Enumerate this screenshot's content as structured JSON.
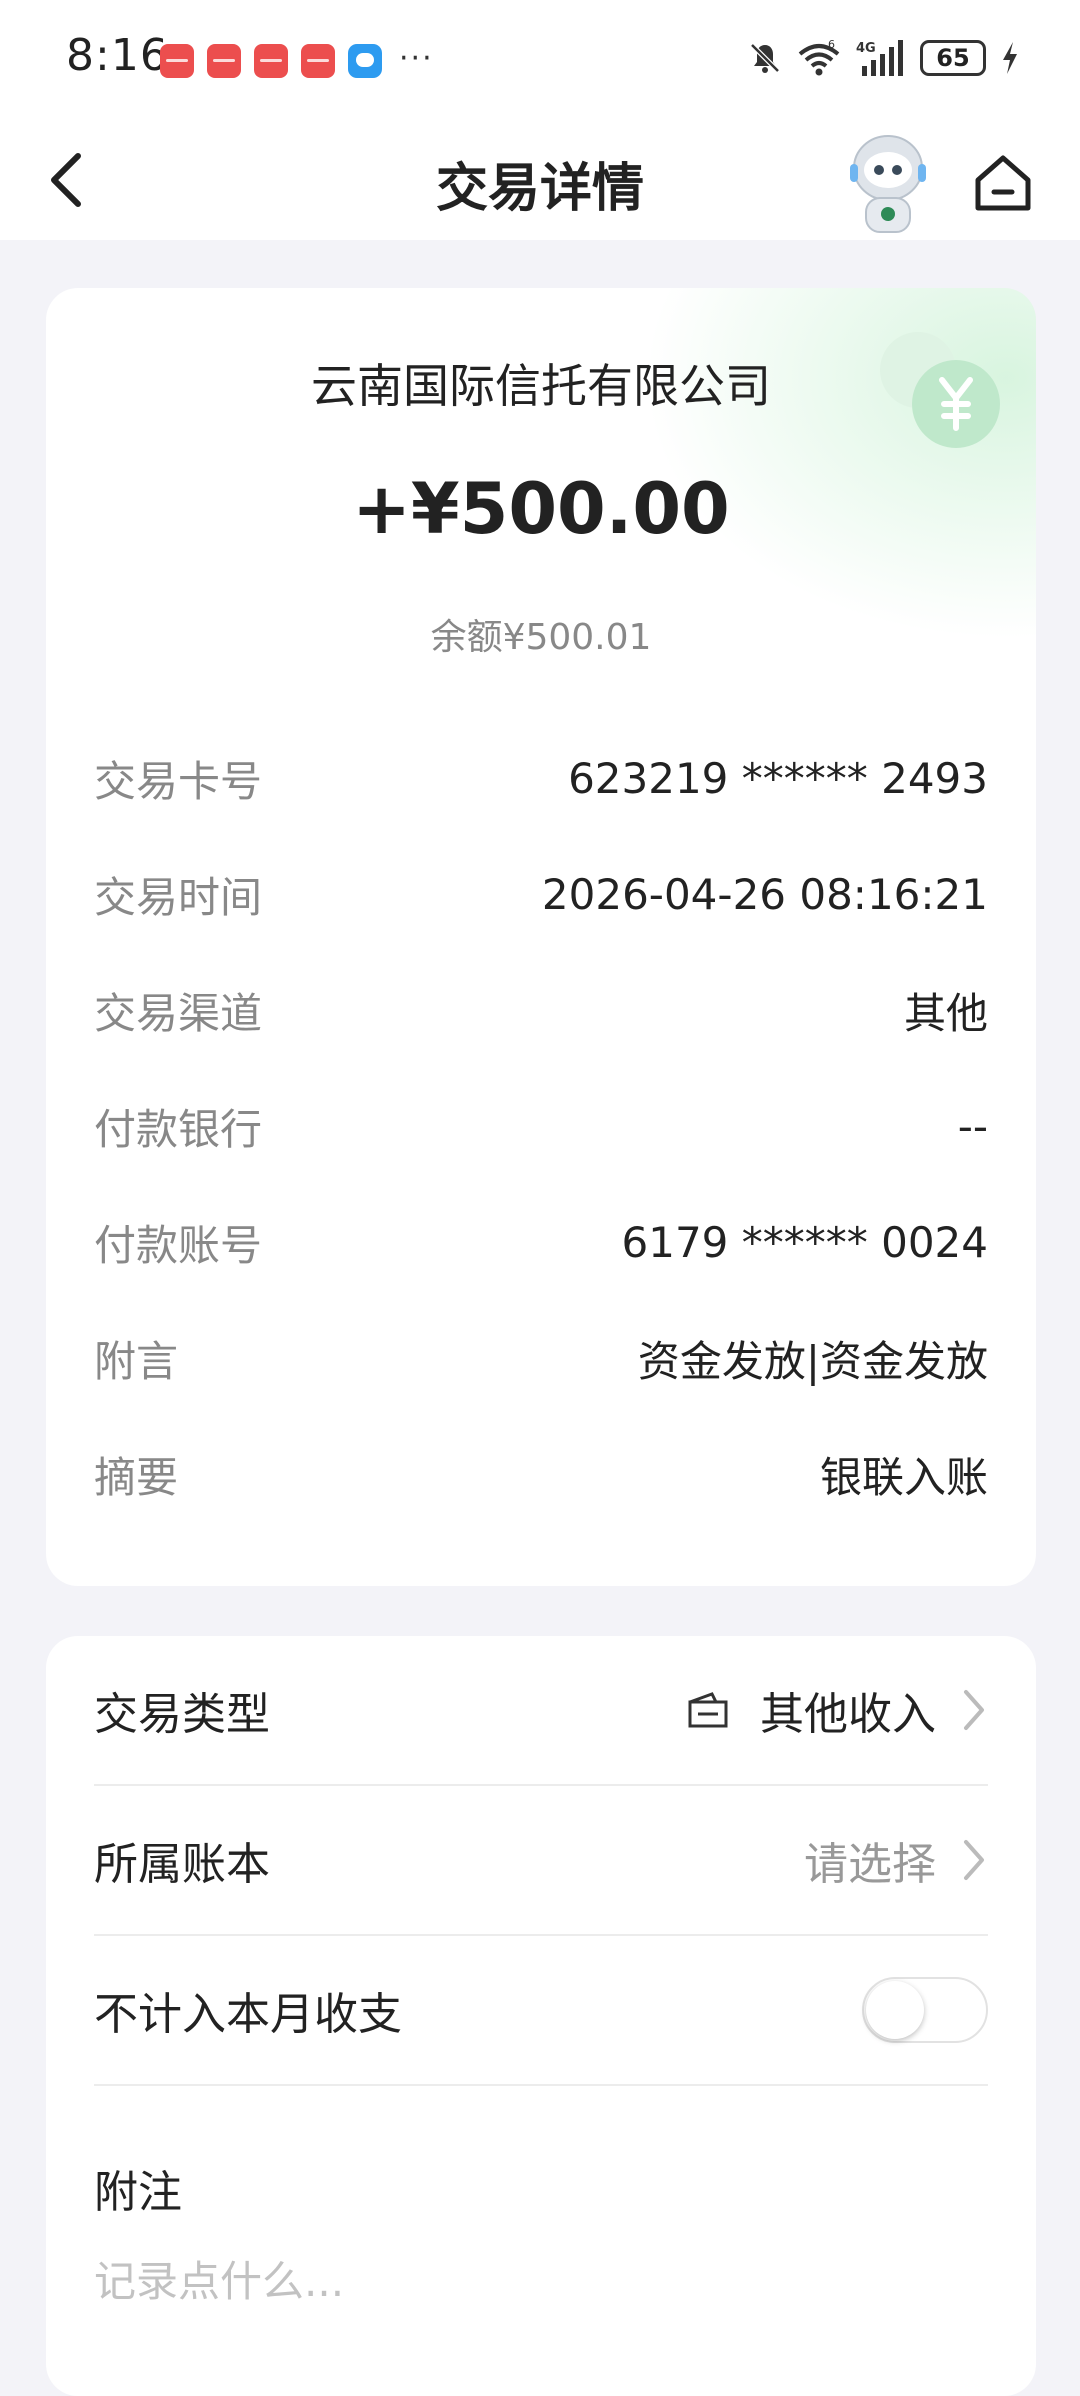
{
  "status_bar": {
    "time": "8:16",
    "notification_icons": [
      "huawei-store-icon",
      "huawei-store-icon",
      "huawei-store-icon",
      "huawei-store-icon",
      "message-icon"
    ],
    "more": "···",
    "battery": "65"
  },
  "nav": {
    "title": "交易详情"
  },
  "transaction": {
    "merchant": "云南国际信托有限公司",
    "amount": "+¥500.00",
    "balance": "余额¥500.01",
    "details": [
      {
        "label": "交易卡号",
        "value": "623219 ****** 2493"
      },
      {
        "label": "交易时间",
        "value": "2026-04-26 08:16:21"
      },
      {
        "label": "交易渠道",
        "value": "其他"
      },
      {
        "label": "付款银行",
        "value": "--"
      },
      {
        "label": "付款账号",
        "value": "6179 ****** 0024"
      },
      {
        "label": "附言",
        "value": "资金发放|资金发放"
      },
      {
        "label": "摘要",
        "value": "银联入账"
      }
    ]
  },
  "settings": {
    "type": {
      "label": "交易类型",
      "value": "其他收入"
    },
    "ledger": {
      "label": "所属账本",
      "value": "请选择"
    },
    "exclude": {
      "label": "不计入本月收支",
      "enabled": false
    },
    "note": {
      "label": "附注",
      "placeholder": "记录点什么..."
    }
  },
  "colors": {
    "accent_green": "#4cc67a",
    "background": "#f3f3f8",
    "card": "#ffffff"
  }
}
